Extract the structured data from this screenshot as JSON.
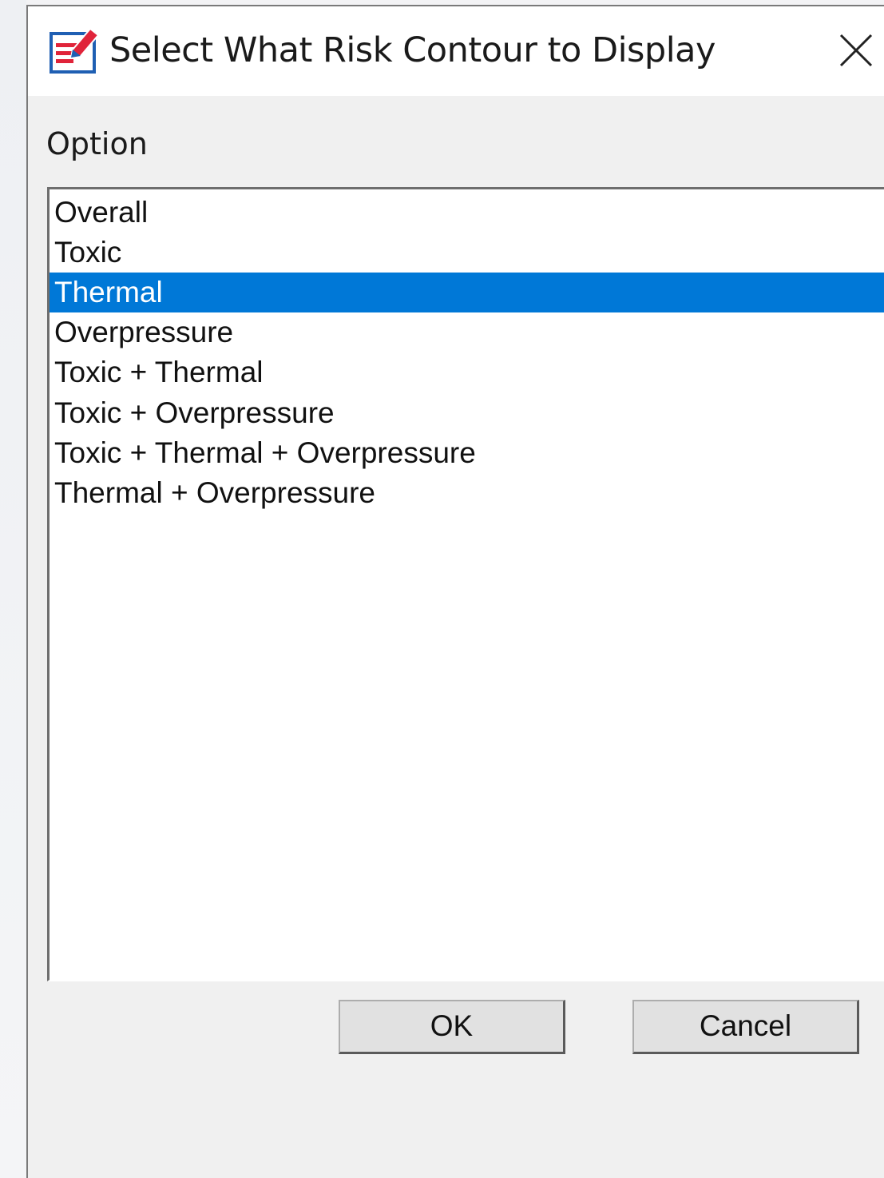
{
  "window": {
    "title": "Select What Risk Contour to Display",
    "icon": "document-edit-icon",
    "close_icon": "close-icon"
  },
  "form": {
    "option_label": "Option"
  },
  "listbox": {
    "selected_index": 2,
    "items": [
      {
        "label": "Overall"
      },
      {
        "label": "Toxic"
      },
      {
        "label": "Thermal"
      },
      {
        "label": "Overpressure"
      },
      {
        "label": "Toxic + Thermal"
      },
      {
        "label": "Toxic + Overpressure"
      },
      {
        "label": "Toxic + Thermal + Overpressure"
      },
      {
        "label": "Thermal + Overpressure"
      }
    ]
  },
  "buttons": {
    "ok_label": "OK",
    "cancel_label": "Cancel"
  },
  "colors": {
    "selection": "#0078d7",
    "icon_red": "#e0243a",
    "icon_blue": "#1f5fb3"
  }
}
